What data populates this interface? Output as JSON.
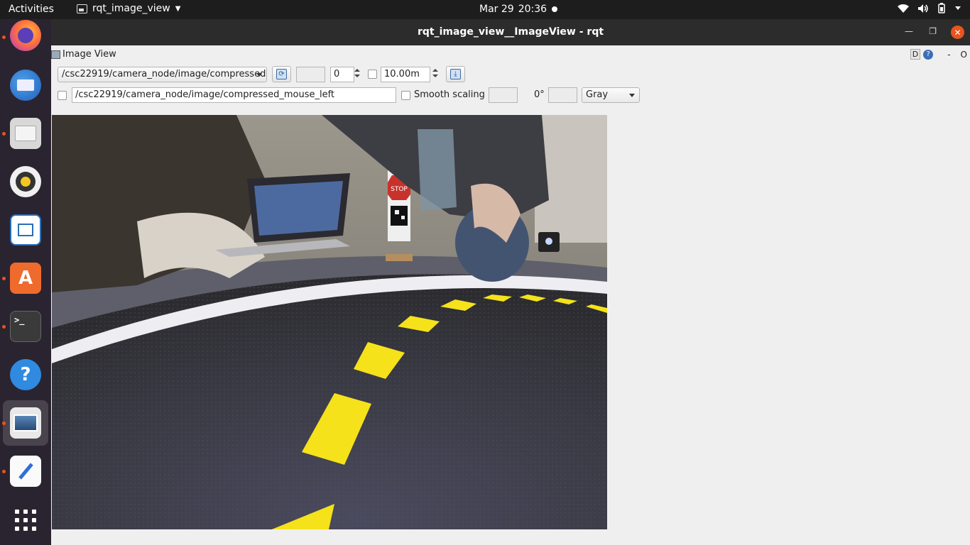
{
  "topbar": {
    "activities": "Activities",
    "app_name": "rqt_image_view",
    "date": "Mar 29",
    "time": "20:36"
  },
  "dock": {
    "items": [
      {
        "name": "firefox-icon",
        "running": true
      },
      {
        "name": "thunderbird-icon",
        "running": false
      },
      {
        "name": "files-icon",
        "running": true
      },
      {
        "name": "rhythmbox-icon",
        "running": false
      },
      {
        "name": "libreoffice-writer-icon",
        "running": false
      },
      {
        "name": "software-center-icon",
        "running": true
      },
      {
        "name": "terminal-icon",
        "running": true
      },
      {
        "name": "help-icon",
        "running": false
      },
      {
        "name": "image-viewer-icon",
        "running": true
      },
      {
        "name": "text-editor-icon",
        "running": true
      },
      {
        "name": "show-apps-icon",
        "running": false
      }
    ]
  },
  "window": {
    "title": "rqt_image_view__ImageView - rqt",
    "plugin_title": "Image View",
    "plugin_d": "D",
    "plugin_help": "?",
    "plugin_dash": "-",
    "plugin_o": "O"
  },
  "toolbar": {
    "topic": "/csc22919/camera_node/image/compressed",
    "number_value": "0",
    "time_value": "10.00m",
    "mouse_topic": "/csc22919/camera_node/image/compressed_mouse_left",
    "smooth_scaling_label": "Smooth scaling",
    "rotation_label": "0°",
    "color_scheme": "Gray"
  },
  "image_texts": {
    "stop_sign": "STOP"
  }
}
